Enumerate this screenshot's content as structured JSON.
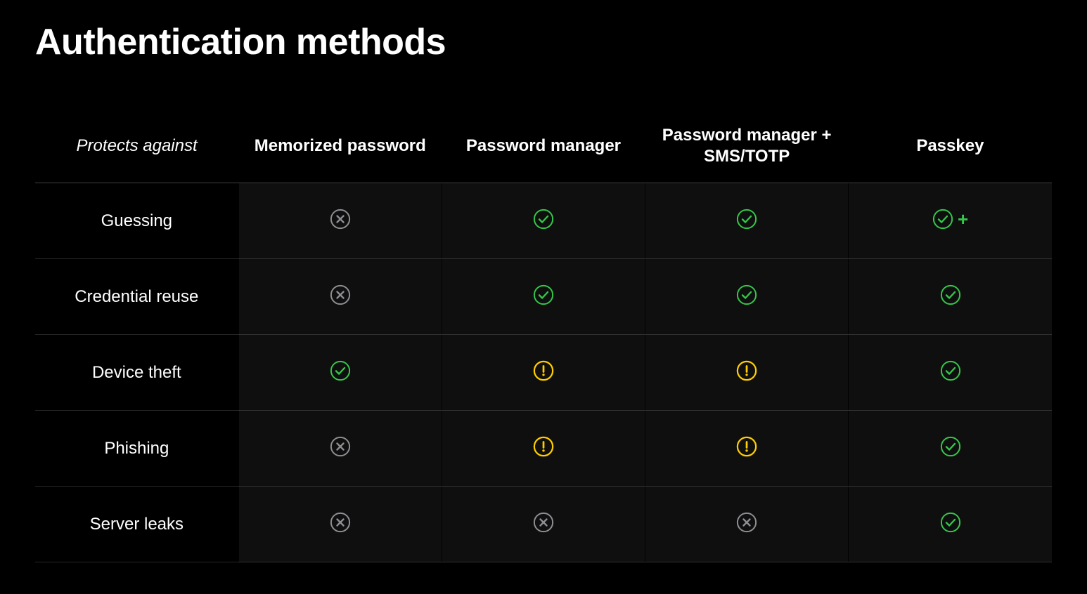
{
  "title": "Authentication methods",
  "header": {
    "row_label": "Protects against",
    "columns": [
      "Memorized password",
      "Password manager",
      "Password manager + SMS/TOTP",
      "Passkey"
    ]
  },
  "rows": [
    {
      "label": "Guessing",
      "cells": [
        {
          "icon": "cross",
          "plus": false
        },
        {
          "icon": "check",
          "plus": false
        },
        {
          "icon": "check",
          "plus": false
        },
        {
          "icon": "check",
          "plus": true
        }
      ]
    },
    {
      "label": "Credential reuse",
      "cells": [
        {
          "icon": "cross",
          "plus": false
        },
        {
          "icon": "check",
          "plus": false
        },
        {
          "icon": "check",
          "plus": false
        },
        {
          "icon": "check",
          "plus": false
        }
      ]
    },
    {
      "label": "Device theft",
      "cells": [
        {
          "icon": "check",
          "plus": false
        },
        {
          "icon": "warn",
          "plus": false
        },
        {
          "icon": "warn",
          "plus": false
        },
        {
          "icon": "check",
          "plus": false
        }
      ]
    },
    {
      "label": "Phishing",
      "cells": [
        {
          "icon": "cross",
          "plus": false
        },
        {
          "icon": "warn",
          "plus": false
        },
        {
          "icon": "warn",
          "plus": false
        },
        {
          "icon": "check",
          "plus": false
        }
      ]
    },
    {
      "label": "Server leaks",
      "cells": [
        {
          "icon": "cross",
          "plus": false
        },
        {
          "icon": "cross",
          "plus": false
        },
        {
          "icon": "cross",
          "plus": false
        },
        {
          "icon": "check",
          "plus": false
        }
      ]
    }
  ],
  "icons": {
    "check": {
      "color": "green",
      "name": "check-circle-icon"
    },
    "cross": {
      "color": "grey",
      "name": "cross-circle-icon"
    },
    "warn": {
      "color": "yellow",
      "name": "warning-circle-icon"
    }
  },
  "plus_glyph": "+"
}
